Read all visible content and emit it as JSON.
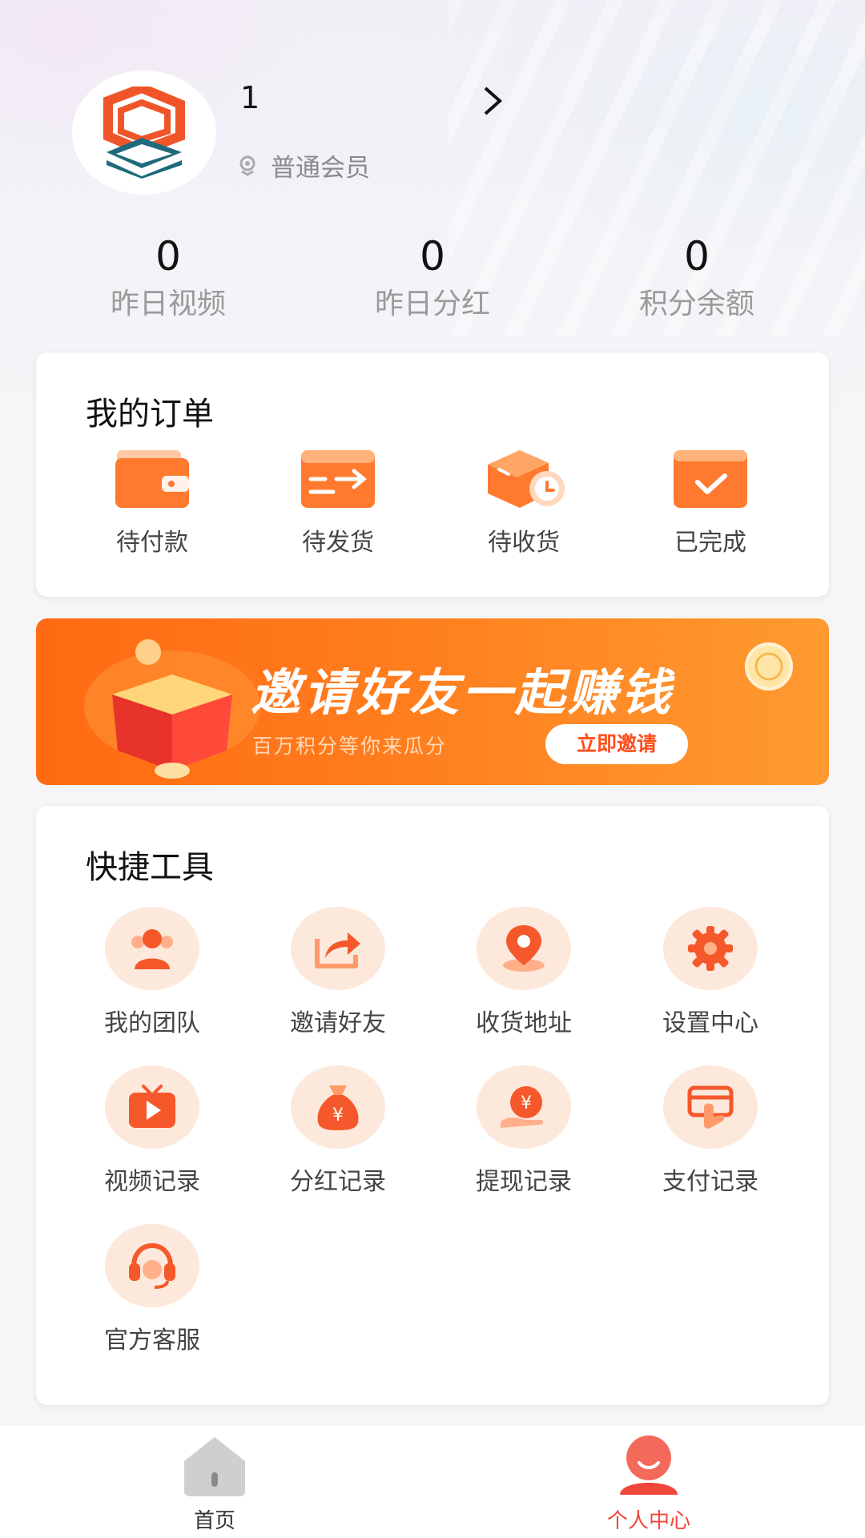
{
  "profile": {
    "username": "1",
    "member_level": "普通会员"
  },
  "stats": [
    {
      "value": "0",
      "label": "昨日视频"
    },
    {
      "value": "0",
      "label": "昨日分红"
    },
    {
      "value": "0",
      "label": "积分余额"
    }
  ],
  "orders": {
    "title": "我的订单",
    "items": [
      {
        "label": "待付款",
        "icon": "wallet-icon"
      },
      {
        "label": "待发货",
        "icon": "shipping-transfer-icon"
      },
      {
        "label": "待收货",
        "icon": "parcel-clock-icon"
      },
      {
        "label": "已完成",
        "icon": "check-box-icon"
      }
    ]
  },
  "banner": {
    "title": "邀请好友一起赚钱",
    "subtitle": "百万积分等你来瓜分",
    "button": "立即邀请"
  },
  "tools": {
    "title": "快捷工具",
    "items": [
      {
        "label": "我的团队",
        "icon": "team-icon"
      },
      {
        "label": "邀请好友",
        "icon": "share-icon"
      },
      {
        "label": "收货地址",
        "icon": "location-pin-icon"
      },
      {
        "label": "设置中心",
        "icon": "gear-icon"
      },
      {
        "label": "视频记录",
        "icon": "tv-play-icon"
      },
      {
        "label": "分红记录",
        "icon": "money-bag-icon"
      },
      {
        "label": "提现记录",
        "icon": "yen-coin-hand-icon"
      },
      {
        "label": "支付记录",
        "icon": "payment-card-icon"
      },
      {
        "label": "官方客服",
        "icon": "headset-icon"
      }
    ]
  },
  "tabbar": {
    "items": [
      {
        "label": "首页",
        "icon": "home-icon",
        "active": false
      },
      {
        "label": "个人中心",
        "icon": "user-smile-icon",
        "active": true
      }
    ]
  },
  "colors": {
    "accent": "#ff6a12",
    "active_tab": "#f0463c",
    "icon_bg": "#fde8dc"
  }
}
